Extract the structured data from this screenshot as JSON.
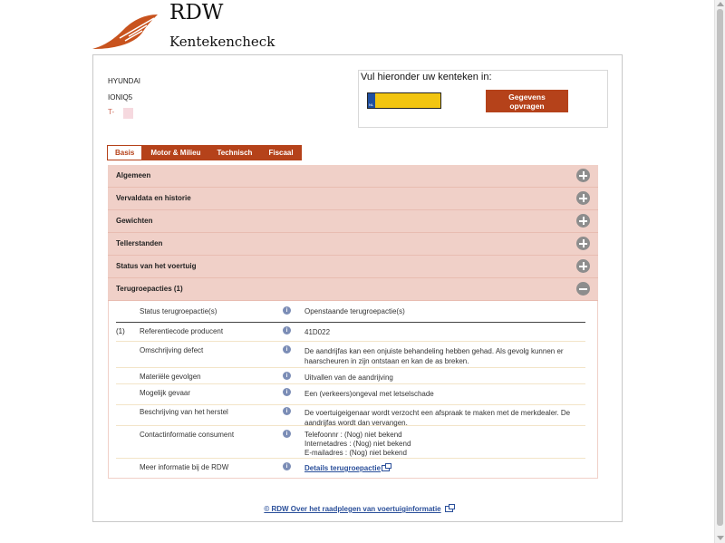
{
  "header": {
    "brand": "RDW",
    "subtitle": "Kentekencheck"
  },
  "vehicle": {
    "make": "HYUNDAI",
    "model": "IONIQ5",
    "plate_prefix": "T-"
  },
  "lookup": {
    "label": "Vul hieronder uw kenteken in:",
    "input_value": "",
    "eu_badge": "NL",
    "button_label": "Gegevens opvragen"
  },
  "tabs": [
    {
      "label": "Basis",
      "active": true
    },
    {
      "label": "Motor & Milieu",
      "active": false
    },
    {
      "label": "Technisch",
      "active": false
    },
    {
      "label": "Fiscaal",
      "active": false
    }
  ],
  "sections": [
    {
      "label": "Algemeen",
      "expanded": false
    },
    {
      "label": "Vervaldata en historie",
      "expanded": false
    },
    {
      "label": "Gewichten",
      "expanded": false
    },
    {
      "label": "Tellerstanden",
      "expanded": false
    },
    {
      "label": "Status van het voertuig",
      "expanded": false
    },
    {
      "label": "Terugroepacties (1)",
      "expanded": true
    }
  ],
  "recall": {
    "header": {
      "label": "Status terugroepactie(s)",
      "value": "Openstaande terugroepactie(s)"
    },
    "index": "(1)",
    "rows": [
      {
        "label": "Referentiecode producent",
        "lines": [
          "41D022"
        ]
      },
      {
        "label": "Omschrijving defect",
        "lines": [
          "De aandrijfas kan een onjuiste behandeling hebben gehad. Als gevolg kunnen er",
          "haarscheuren in zijn ontstaan en kan de as breken."
        ]
      },
      {
        "label": "Materiële gevolgen",
        "lines": [
          "Uitvallen van de aandrijving"
        ]
      },
      {
        "label": "Mogelijk gevaar",
        "lines": [
          "Een (verkeers)ongeval met letselschade"
        ]
      },
      {
        "label": "Beschrijving van het herstel",
        "lines": [
          "De voertuigeigenaar wordt verzocht een afspraak te maken met de merkdealer. De",
          "aandrijfas wordt dan vervangen."
        ]
      },
      {
        "label": "Contactinformatie consument",
        "lines": [
          "Telefoonnr      : (Nog) niet bekend",
          "Internetadres : (Nog) niet bekend",
          "E-mailadres  : (Nog) niet bekend"
        ]
      }
    ],
    "more_info": {
      "label": "Meer informatie bij de RDW",
      "link": "Details terugroepactie"
    }
  },
  "footer": {
    "link": "© RDW  Over het raadplegen van voertuiginformatie"
  },
  "colors": {
    "accent": "#b5421a",
    "accordion_bg": "#f0d0c8",
    "plate_yellow": "#f2c511",
    "link": "#2a4f9a"
  }
}
